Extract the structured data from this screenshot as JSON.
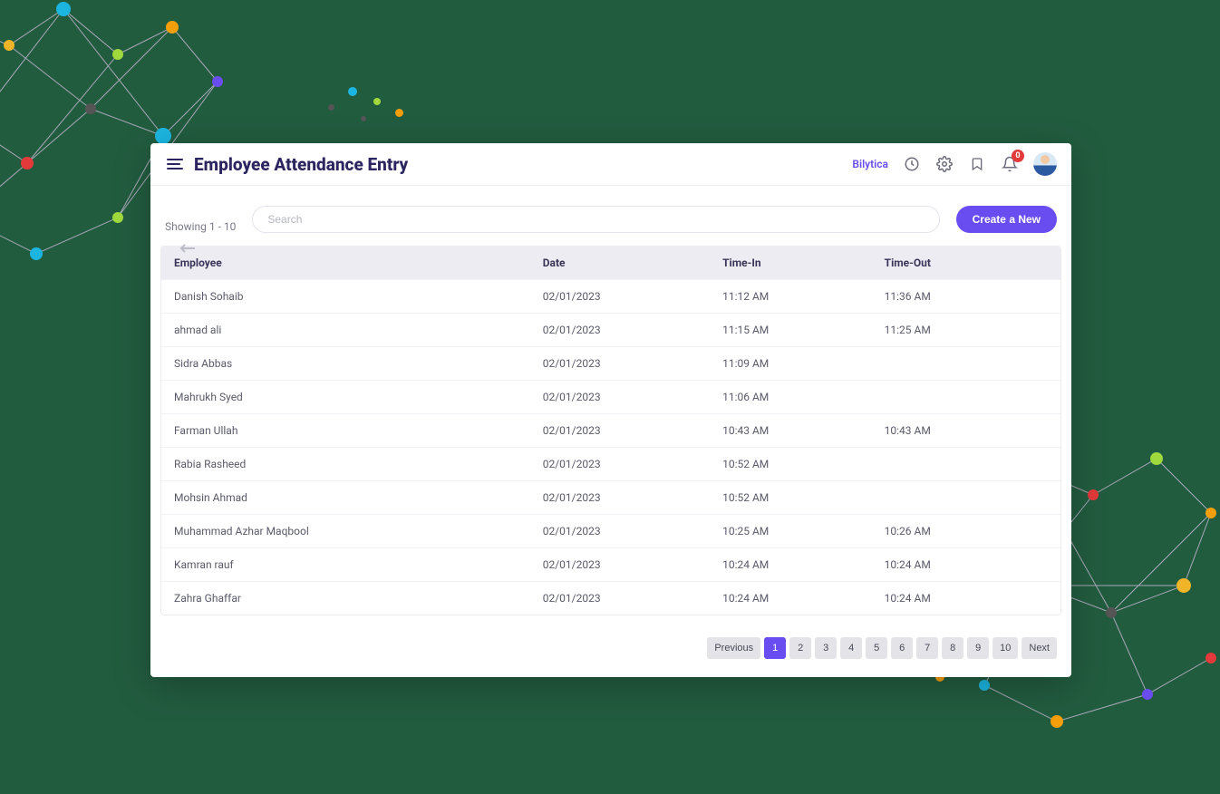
{
  "header": {
    "title": "Employee Attendance Entry",
    "brand": "Bilytica",
    "badge_count": "0"
  },
  "toolbar": {
    "showing": "Showing 1 - 10",
    "search_placeholder": "Search",
    "create_label": "Create a New"
  },
  "table": {
    "columns": {
      "employee": "Employee",
      "date": "Date",
      "time_in": "Time-In",
      "time_out": "Time-Out"
    },
    "rows": [
      {
        "employee": "Danish Sohaib",
        "date": "02/01/2023",
        "time_in": "11:12 AM",
        "time_out": "11:36 AM"
      },
      {
        "employee": "ahmad ali",
        "date": "02/01/2023",
        "time_in": "11:15 AM",
        "time_out": "11:25 AM"
      },
      {
        "employee": "Sidra Abbas",
        "date": "02/01/2023",
        "time_in": "11:09 AM",
        "time_out": ""
      },
      {
        "employee": "Mahrukh Syed",
        "date": "02/01/2023",
        "time_in": "11:06 AM",
        "time_out": ""
      },
      {
        "employee": "Farman Ullah",
        "date": "02/01/2023",
        "time_in": "10:43 AM",
        "time_out": "10:43 AM"
      },
      {
        "employee": "Rabia Rasheed",
        "date": "02/01/2023",
        "time_in": "10:52 AM",
        "time_out": ""
      },
      {
        "employee": "Mohsin Ahmad",
        "date": "02/01/2023",
        "time_in": "10:52 AM",
        "time_out": ""
      },
      {
        "employee": "Muhammad Azhar Maqbool",
        "date": "02/01/2023",
        "time_in": "10:25 AM",
        "time_out": "10:26 AM"
      },
      {
        "employee": "Kamran rauf",
        "date": "02/01/2023",
        "time_in": "10:24 AM",
        "time_out": "10:24 AM"
      },
      {
        "employee": "Zahra Ghaffar",
        "date": "02/01/2023",
        "time_in": "10:24 AM",
        "time_out": "10:24 AM"
      }
    ]
  },
  "pagination": {
    "previous": "Previous",
    "next": "Next",
    "pages": [
      "1",
      "2",
      "3",
      "4",
      "5",
      "6",
      "7",
      "8",
      "9",
      "10"
    ],
    "active": "1"
  }
}
